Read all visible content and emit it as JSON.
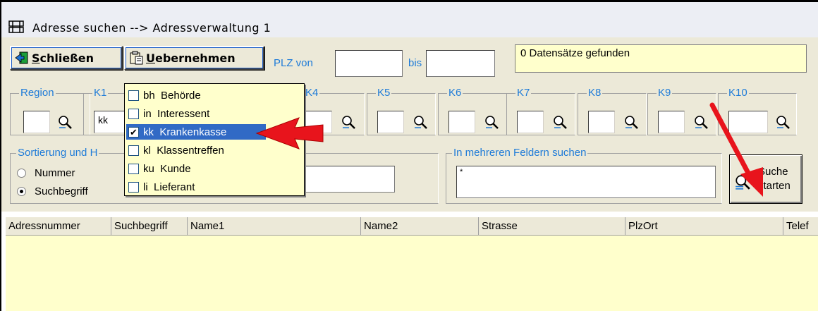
{
  "window": {
    "title": "Adresse suchen --> Adressverwaltung 1"
  },
  "toolbar": {
    "close_label": "Schließen",
    "close_hotkey": "S",
    "close_rest": "chließen",
    "take_label": "Uebernehmen",
    "take_hotkey": "U",
    "take_rest": "ebernehmen",
    "plz_from_label": "PLZ von",
    "plz_from_value": "",
    "plz_to_label": "bis",
    "plz_to_value": ""
  },
  "status": {
    "text": "0 Datensätze gefunden"
  },
  "filters": {
    "region": {
      "label": "Region",
      "value": ""
    },
    "k1": {
      "label": "K1",
      "value": "kk"
    },
    "k4": {
      "label": "K4",
      "value": ""
    },
    "k5": {
      "label": "K5",
      "value": ""
    },
    "k6": {
      "label": "K6",
      "value": ""
    },
    "k7": {
      "label": "K7",
      "value": ""
    },
    "k8": {
      "label": "K8",
      "value": ""
    },
    "k9": {
      "label": "K9",
      "value": ""
    },
    "k10": {
      "label": "K10",
      "value": ""
    }
  },
  "sort": {
    "legend": "Sortierung und H",
    "options": [
      {
        "label": "Nummer",
        "selected": false
      },
      {
        "label": "Suchbegriff",
        "selected": true
      }
    ],
    "value": ""
  },
  "multi_search": {
    "legend": "In mehreren Feldern suchen",
    "value": "*"
  },
  "search_button": {
    "line1": "Suche",
    "line2": "starten"
  },
  "dropdown": {
    "items": [
      {
        "code": "bh",
        "label": "Behörde",
        "checked": false,
        "selected": false
      },
      {
        "code": "in",
        "label": "Interessent",
        "checked": false,
        "selected": false
      },
      {
        "code": "kk",
        "label": "Krankenkasse",
        "checked": true,
        "selected": true
      },
      {
        "code": "kl",
        "label": "Klassentreffen",
        "checked": false,
        "selected": false
      },
      {
        "code": "ku",
        "label": "Kunde",
        "checked": false,
        "selected": false
      },
      {
        "code": "li",
        "label": "Lieferant",
        "checked": false,
        "selected": false
      }
    ]
  },
  "list": {
    "columns": [
      "Adressnummer",
      "Suchbegriff",
      "Name1",
      "Name2",
      "Strasse",
      "PlzOrt",
      "Telef"
    ],
    "rows": []
  },
  "colors": {
    "accent": "#1e7bd8",
    "highlight": "#316ac5",
    "field_bg": "#ffffcc",
    "arrow": "#e8141c"
  }
}
